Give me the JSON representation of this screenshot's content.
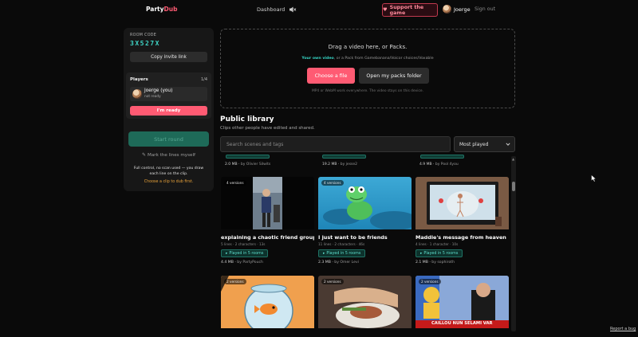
{
  "header": {
    "brand_part1": "Party",
    "brand_part2": "Dub",
    "nav_dashboard": "Dashboard",
    "support_label": "Support the game",
    "user_name": "Joerge",
    "sign_out": "Sign out"
  },
  "room": {
    "code_label": "ROOM CODE",
    "code": "3X527X",
    "copy_invite": "Copy invite link",
    "players_label": "Players",
    "players_count": "1/4",
    "player_name": "Joerge (you)",
    "player_status": "not ready",
    "ready_button": "I'm ready",
    "start_round": "Start round",
    "mark_lines": "Mark the lines myself",
    "full_control": "Full control, no scan used — you draw each line on the clip.",
    "choose_clip": "Choose a clip to dub first."
  },
  "dropzone": {
    "title": "Drag a video here, or Packs.",
    "sub_highlight": "Your own video",
    "sub_rest": ", or a Pack from Gamebanana/Voicor choices/Voxable",
    "choose_file": "Choose a file",
    "open_packs": "Open my packs folder",
    "note": "MP4 or WebM work everywhere. The video stays on this device."
  },
  "library": {
    "title": "Public library",
    "subtitle": "Clips other people have edited and shared.",
    "search_placeholder": "Search scenes and tags",
    "sort_selected": "Most played",
    "prev_row": [
      {
        "size": "2.0 MB",
        "by": "by Olivier Silwits"
      },
      {
        "size": "19.2 MB",
        "by": "by jesse2"
      },
      {
        "size": "4.9 MB",
        "by": "by Pool 4you"
      }
    ],
    "cards": [
      {
        "versions": "4 versions",
        "title": "explaining a chaotic friend group",
        "meta": "5 lines · 2 characters · 13s",
        "played": "Played in 5 rooms",
        "size": "4.4 MB",
        "by": "by PartyPouch"
      },
      {
        "versions": "4 versions",
        "title": "I just want to be friends",
        "meta": "11 lines · 2 characters · 46s",
        "played": "Played in 5 rooms",
        "size": "2.3 MB",
        "by": "by Omer Levi"
      },
      {
        "versions": "",
        "title": "Maddie's message from heaven",
        "meta": "4 lines · 1 character · 10s",
        "played": "Played in 5 rooms",
        "size": "2.1 MB",
        "by": "by sophiroth"
      },
      {
        "versions": "2 versions",
        "title": "",
        "meta": "",
        "played": "",
        "size": "",
        "by": ""
      },
      {
        "versions": "2 versions",
        "title": "",
        "meta": "",
        "played": "",
        "size": "",
        "by": ""
      },
      {
        "versions": "2 versions",
        "title": "",
        "meta": "",
        "played": "",
        "size": "",
        "by": "",
        "caption": "CAILLOU NUN SELAMI VAR"
      }
    ]
  },
  "footer": {
    "report_bug": "Report a bug"
  },
  "colors": {
    "accent": "#ff5b73",
    "teal": "#3fd6c7",
    "background": "#0a0a0a"
  }
}
